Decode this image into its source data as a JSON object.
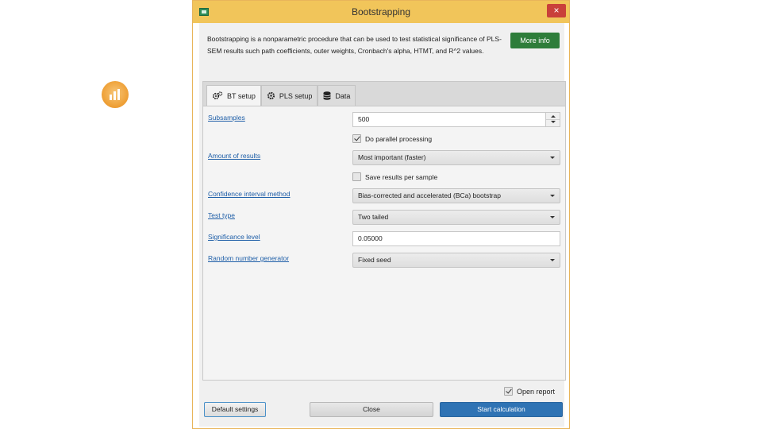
{
  "window": {
    "title": "Bootstrapping",
    "close_glyph": "×"
  },
  "description": "Bootstrapping is a nonparametric procedure that can be used to test statistical significance of PLS-SEM results such path coefficients, outer weights, Cronbach's alpha, HTMT, and R^2 values.",
  "more_info_label": "More info",
  "tabs": [
    {
      "label": "BT setup",
      "icon": "gears-icon",
      "active": true
    },
    {
      "label": "PLS setup",
      "icon": "gear-icon",
      "active": false
    },
    {
      "label": "Data",
      "icon": "database-icon",
      "active": false
    }
  ],
  "form": {
    "subsamples": {
      "label": "Subsamples",
      "value": "500"
    },
    "parallel": {
      "label": "Do parallel processing",
      "checked": true
    },
    "amount": {
      "label": "Amount of results",
      "value": "Most important (faster)"
    },
    "save_per_sample": {
      "label": "Save results per sample",
      "checked": false
    },
    "ci_method": {
      "label": "Confidence interval method",
      "value": "Bias-corrected and accelerated (BCa) bootstrap"
    },
    "test_type": {
      "label": "Test type",
      "value": "Two tailed"
    },
    "significance": {
      "label": "Significance level",
      "value": "0.05000"
    },
    "rng": {
      "label": "Random number generator",
      "value": "Fixed seed"
    }
  },
  "open_report": {
    "label": "Open report",
    "checked": true
  },
  "buttons": {
    "default_settings": "Default settings",
    "close": "Close",
    "start": "Start calculation"
  },
  "colors": {
    "titlebar": "#f1c55a",
    "more_info": "#2e7d3a",
    "primary": "#2f73b4",
    "link": "#1f5fa8",
    "close": "#c9403a"
  }
}
